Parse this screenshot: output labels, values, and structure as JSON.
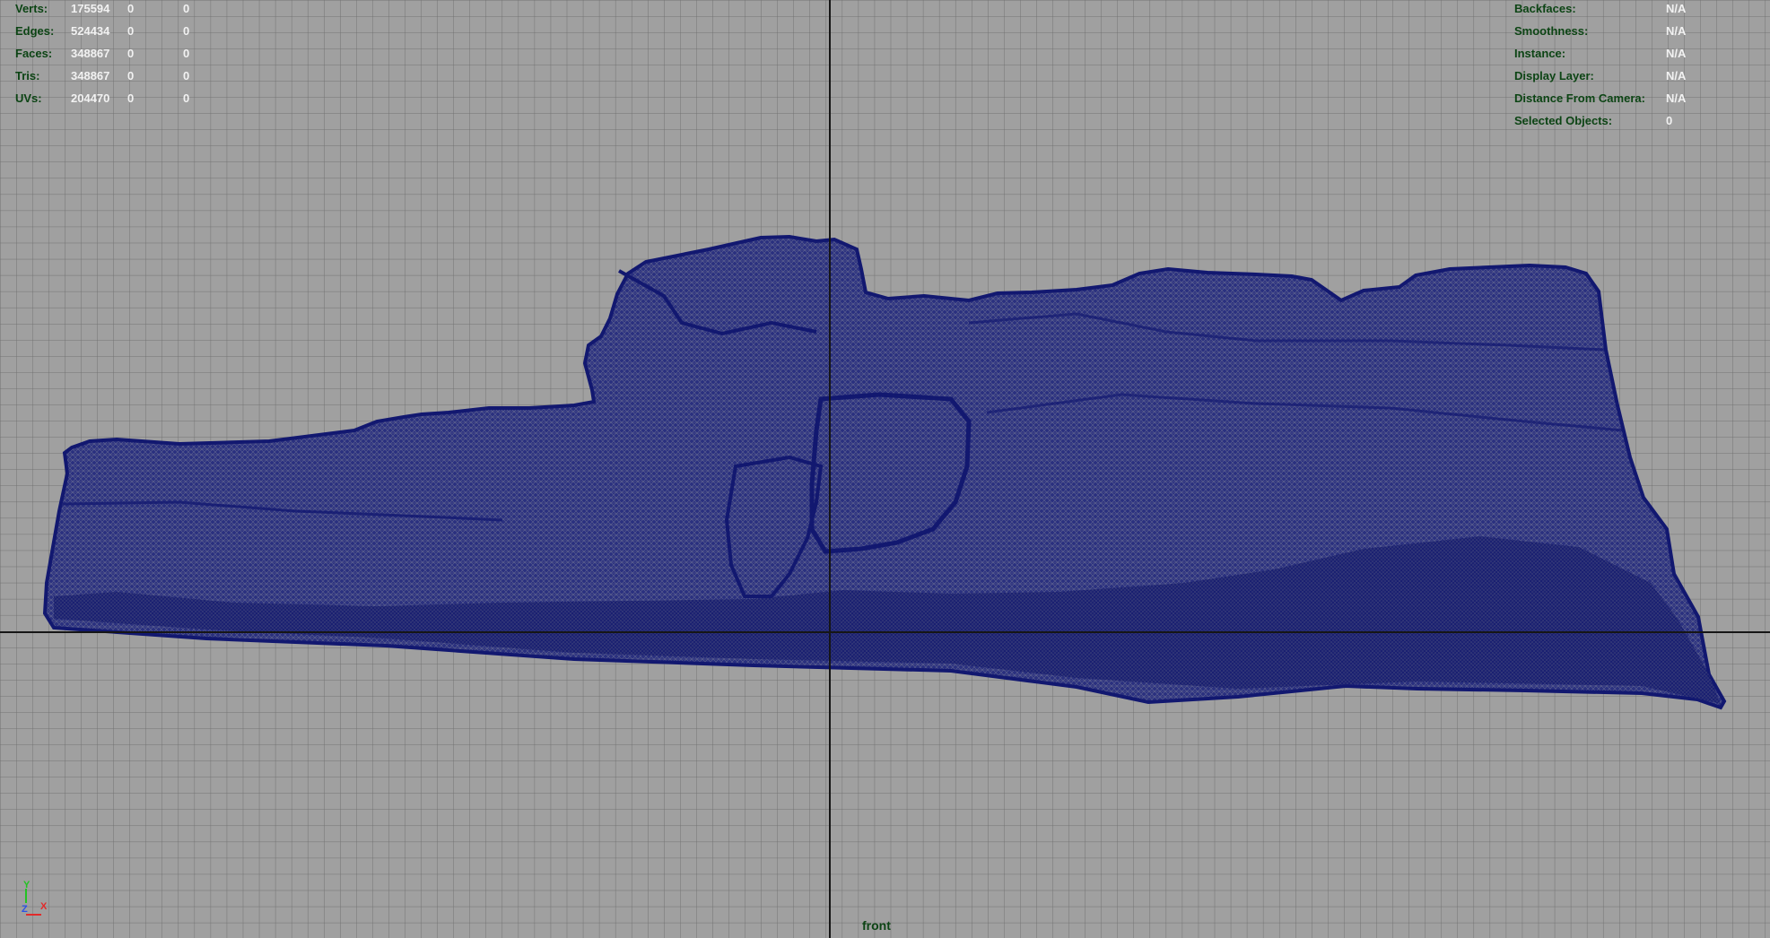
{
  "viewport": {
    "camera": "front",
    "background_color": "#a0a0a0",
    "grid_color": "#707070",
    "axis_line_color": "#161616",
    "mesh_wire_color": "#141a78"
  },
  "poly_count": {
    "rows": [
      {
        "label": "Verts:",
        "total": "175594",
        "selected": "0",
        "selected_component": "0"
      },
      {
        "label": "Edges:",
        "total": "524434",
        "selected": "0",
        "selected_component": "0"
      },
      {
        "label": "Faces:",
        "total": "348867",
        "selected": "0",
        "selected_component": "0"
      },
      {
        "label": "Tris:",
        "total": "348867",
        "selected": "0",
        "selected_component": "0"
      },
      {
        "label": "UVs:",
        "total": "204470",
        "selected": "0",
        "selected_component": "0"
      }
    ]
  },
  "object_details": {
    "rows": [
      {
        "label": "Backfaces:",
        "value": "N/A"
      },
      {
        "label": "Smoothness:",
        "value": "N/A"
      },
      {
        "label": "Instance:",
        "value": "N/A"
      },
      {
        "label": "Display Layer:",
        "value": "N/A"
      },
      {
        "label": "Distance From Camera:",
        "value": "N/A"
      },
      {
        "label": "Selected Objects:",
        "value": "0"
      }
    ]
  },
  "axis_gizmo": {
    "y_label": "Y",
    "z_label": "Z",
    "x_label": "X",
    "y_color": "#22c322",
    "z_color": "#2a52e6",
    "x_color": "#e22a2a"
  }
}
